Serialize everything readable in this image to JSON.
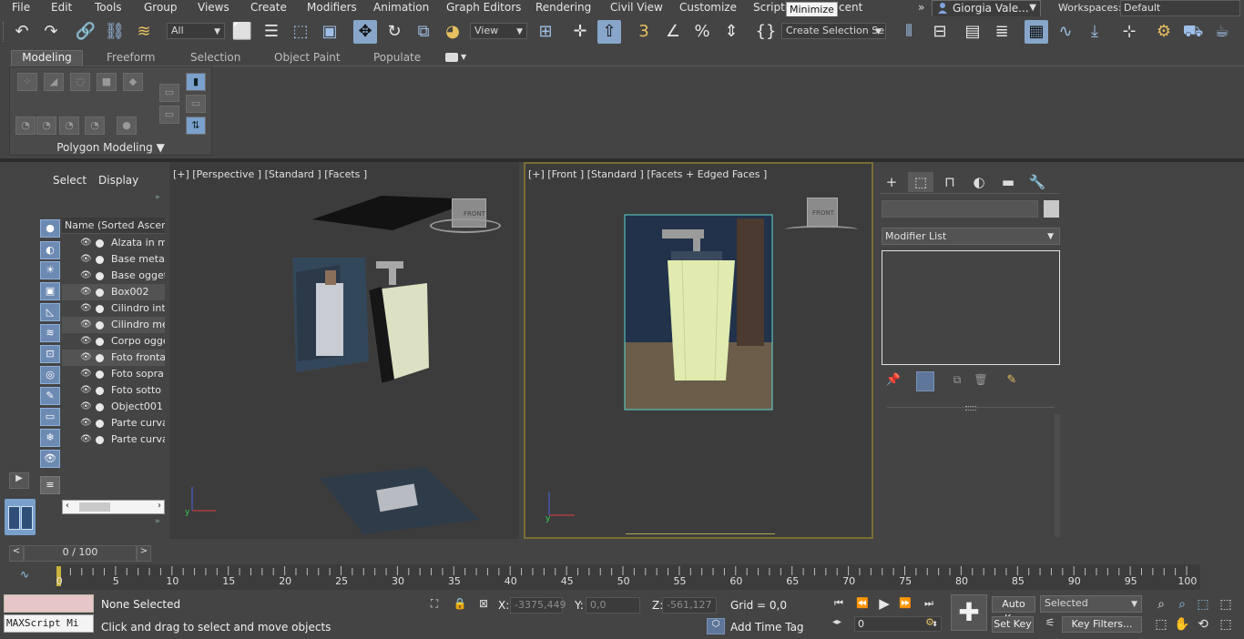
{
  "menu": {
    "items": [
      "File",
      "Edit",
      "Tools",
      "Group",
      "Views",
      "Create",
      "Modifiers",
      "Animation",
      "Graph Editors",
      "Rendering",
      "Civil View",
      "Customize",
      "Scripti",
      "cent"
    ],
    "tooltip": "Minimize",
    "more": "»",
    "user": "Giorgia Vale...",
    "workspaces_label": "Workspaces:",
    "workspace_value": "Default"
  },
  "toolbar": {
    "selection_filter": "All",
    "ref_coord": "View",
    "selection_set": "Create Selection Se"
  },
  "ribbon": {
    "tabs": [
      "Modeling",
      "Freeform",
      "Selection",
      "Object Paint",
      "Populate"
    ],
    "panel_label": "Polygon Modeling"
  },
  "scene_explorer": {
    "tabs": [
      "Select",
      "Display"
    ],
    "column_header": "Name (Sorted Ascendin",
    "objects": [
      "Alzata in me",
      "Base metallo",
      "Base oggett",
      "Box002",
      "Cilindro inter",
      "Cilindro meta",
      "Corpo ogget",
      "Foto frontal",
      "Foto sopra",
      "Foto sotto",
      "Object001",
      "Parte curva",
      "Parte curva"
    ]
  },
  "viewports": {
    "perspective_label": "[+] [Perspective ] [Standard ] [Facets ]",
    "front_label": "[+] [Front ] [Standard ] [Facets + Edged Faces ]",
    "viewcube_persp": "FRONT",
    "viewcube_front": "FRONT"
  },
  "command_panel": {
    "modifier_list": "Modifier List"
  },
  "timeline": {
    "frame_counter": "0 / 100",
    "ticks": [
      "0",
      "5",
      "10",
      "15",
      "20",
      "25",
      "30",
      "35",
      "40",
      "45",
      "50",
      "55",
      "60",
      "65",
      "70",
      "75",
      "80",
      "85",
      "90",
      "95",
      "100"
    ]
  },
  "status": {
    "maxscript": "MAXScript Mi",
    "selection": "None Selected",
    "prompt": "Click and drag to select and move objects",
    "x_label": "X:",
    "x_value": "-3375,449",
    "y_label": "Y:",
    "y_value": "0,0",
    "z_label": "Z:",
    "z_value": "-561,127",
    "grid": "Grid = 0,0",
    "add_time_tag": "Add Time Tag",
    "auto_key": "Auto Key",
    "selected": "Selected",
    "set_key": "Set Key",
    "key_filters": "Key Filters...",
    "current_frame": "0"
  }
}
